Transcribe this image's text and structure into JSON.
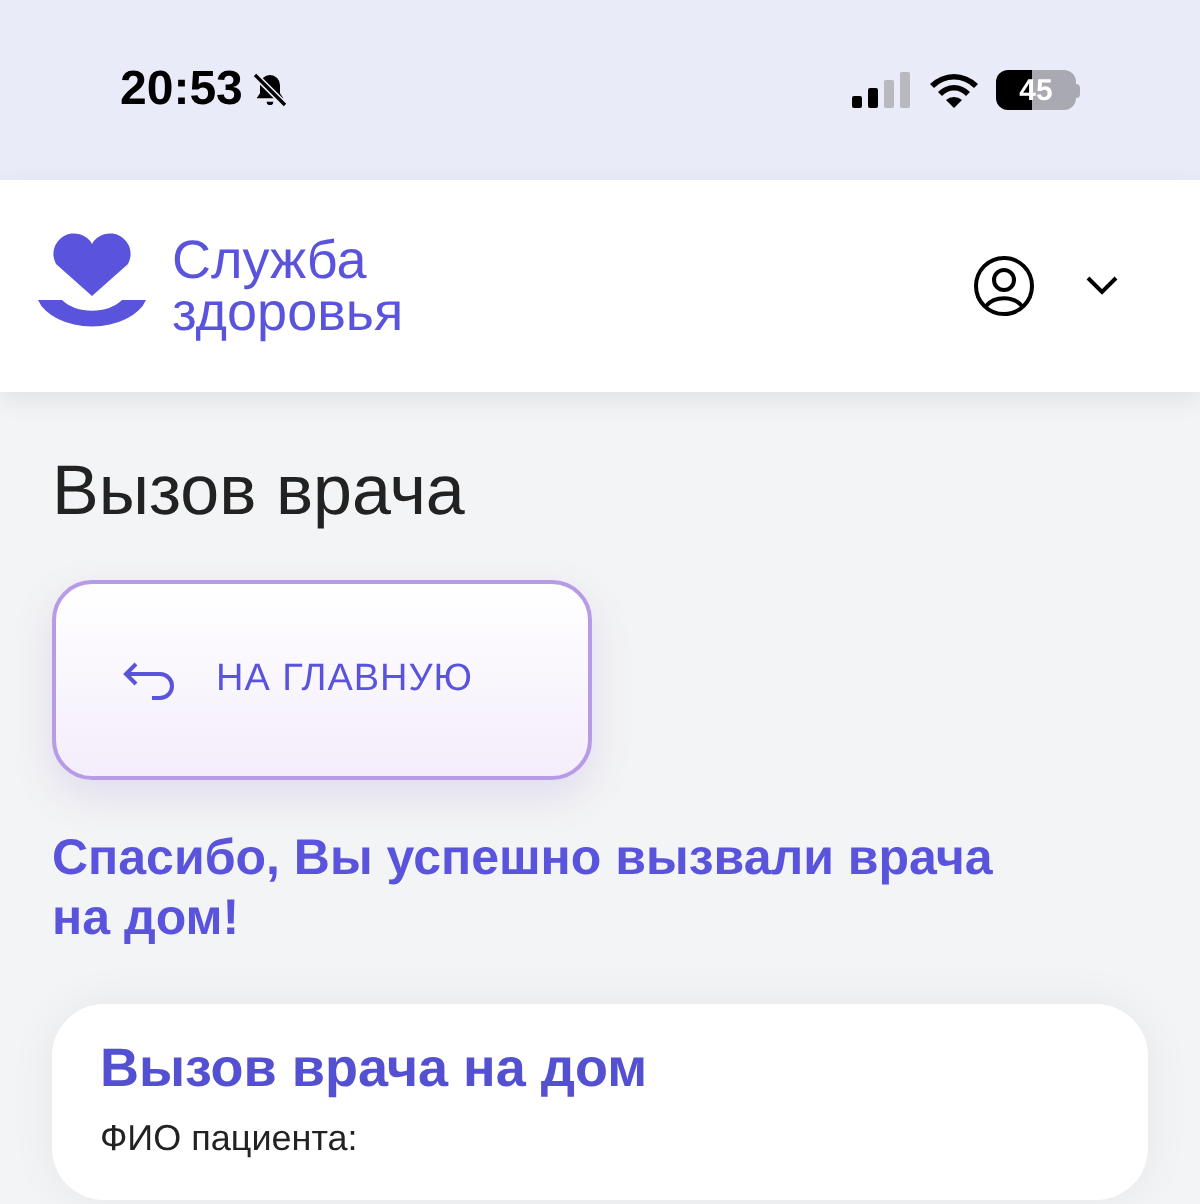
{
  "status_bar": {
    "time": "20:53",
    "battery": "45"
  },
  "header": {
    "logo_line_1": "Служба",
    "logo_line_2": "здоровья"
  },
  "page_title": "Вызов врача",
  "back_button": {
    "label": "НА ГЛАВНУЮ"
  },
  "success_message": "Спасибо, Вы успешно вызвали врача на дом!",
  "card": {
    "title": "Вызов врача на дом",
    "field_label": "ФИО пациента:"
  }
}
